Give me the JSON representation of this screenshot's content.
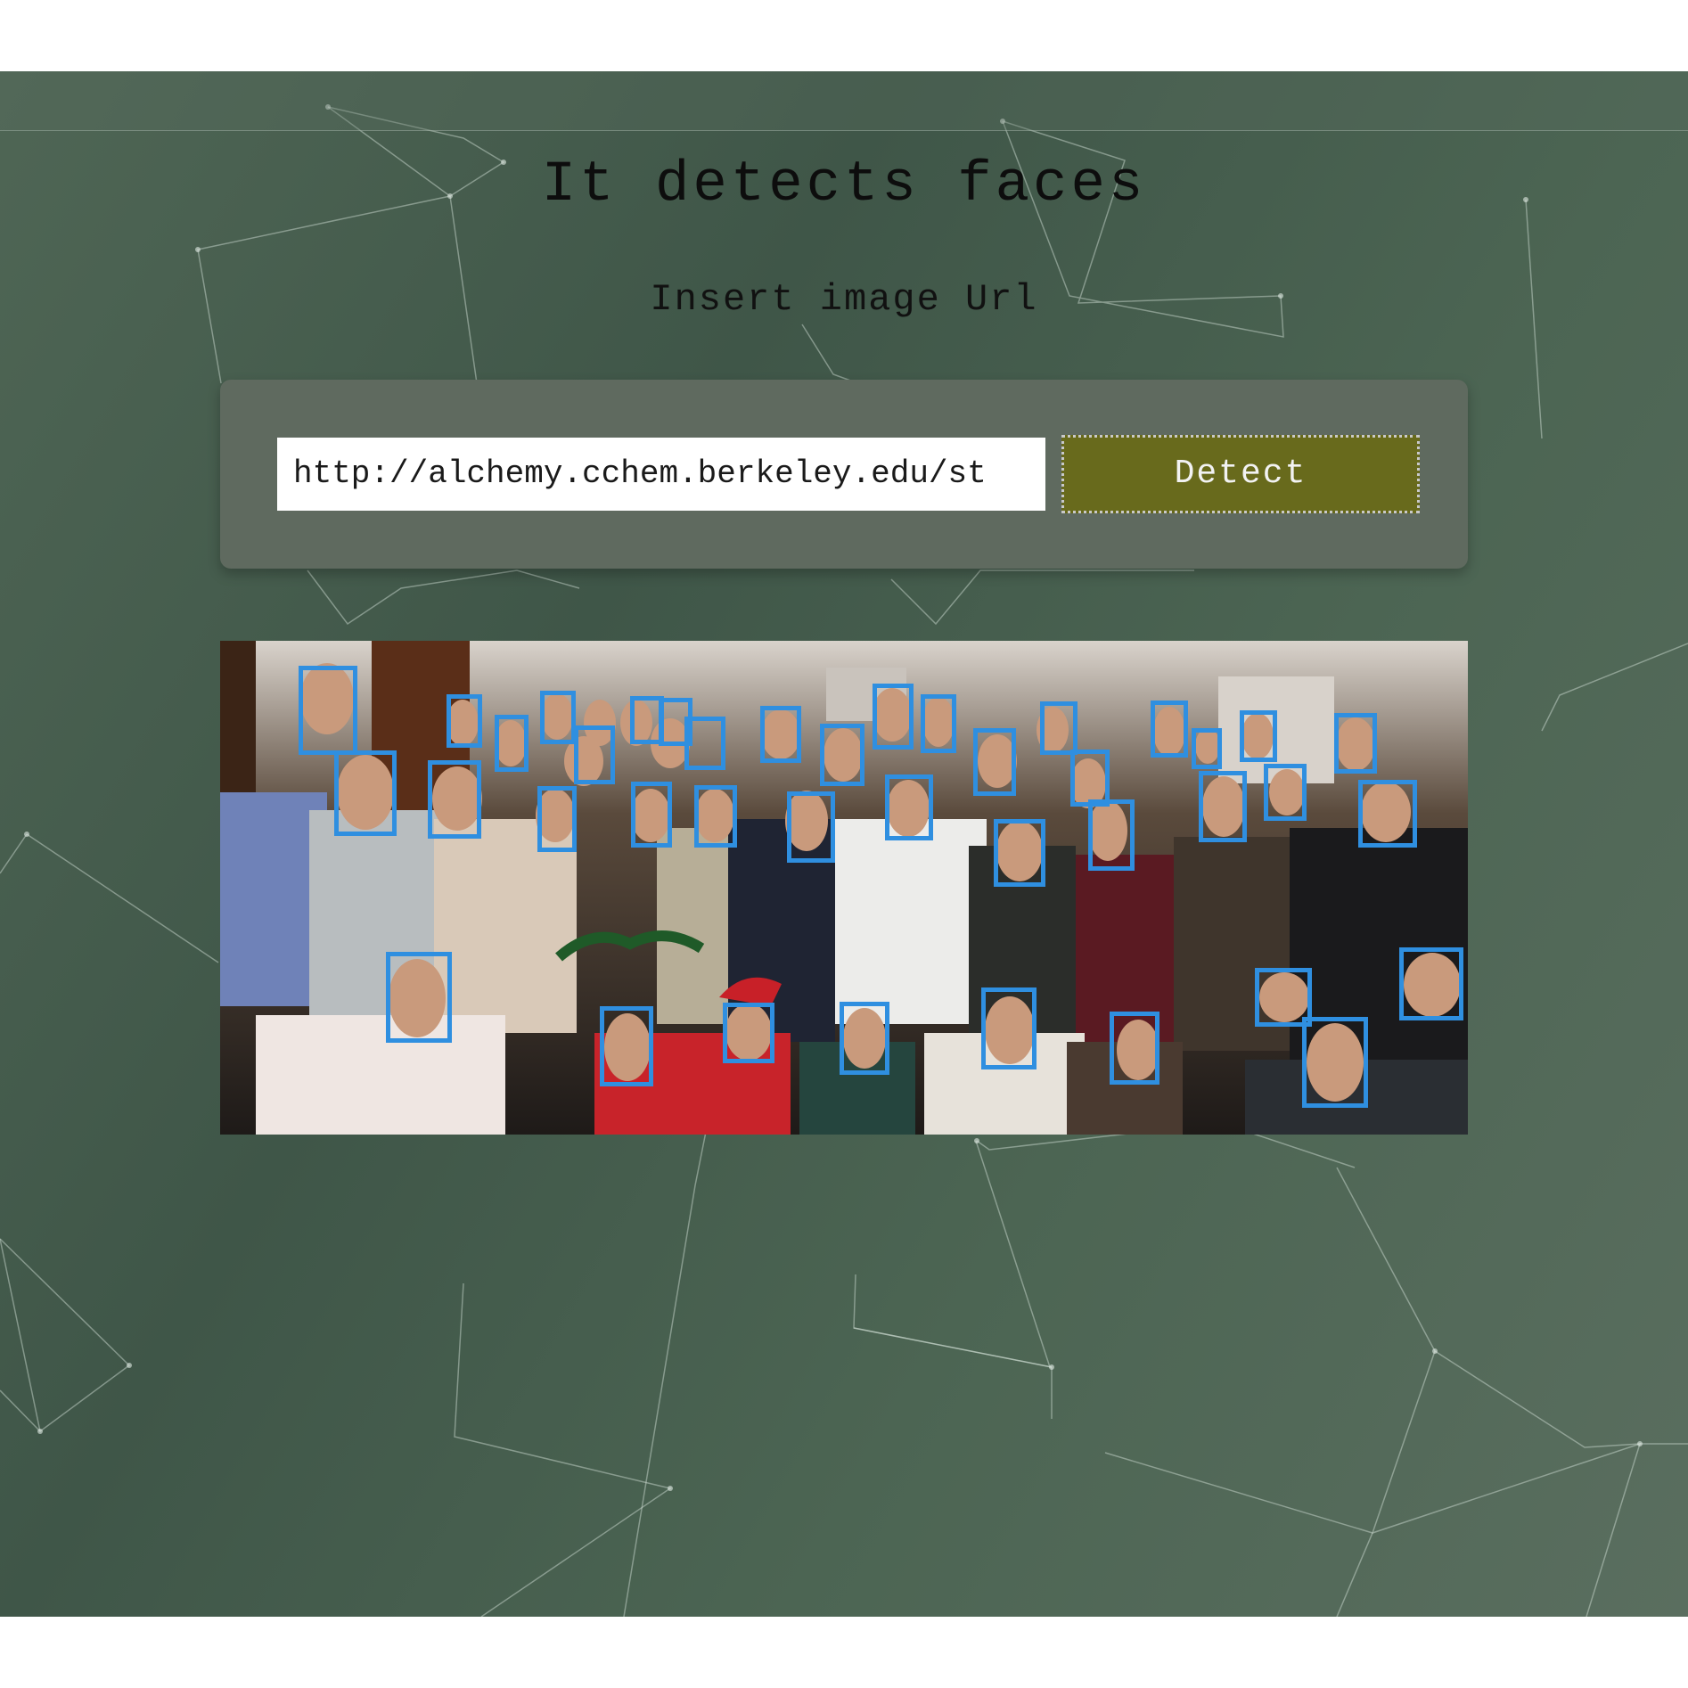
{
  "header": {
    "title": "It detects faces",
    "subtitle": "Insert image Url"
  },
  "form": {
    "url_value": "http://alchemy.cchem.berkeley.edu/st",
    "detect_label": "Detect"
  },
  "result": {
    "face_count": 45,
    "box_color": "#2f8fe0"
  },
  "colors": {
    "background": "#455c4c",
    "card": "#5f6a5f",
    "button": "#686a1c"
  }
}
